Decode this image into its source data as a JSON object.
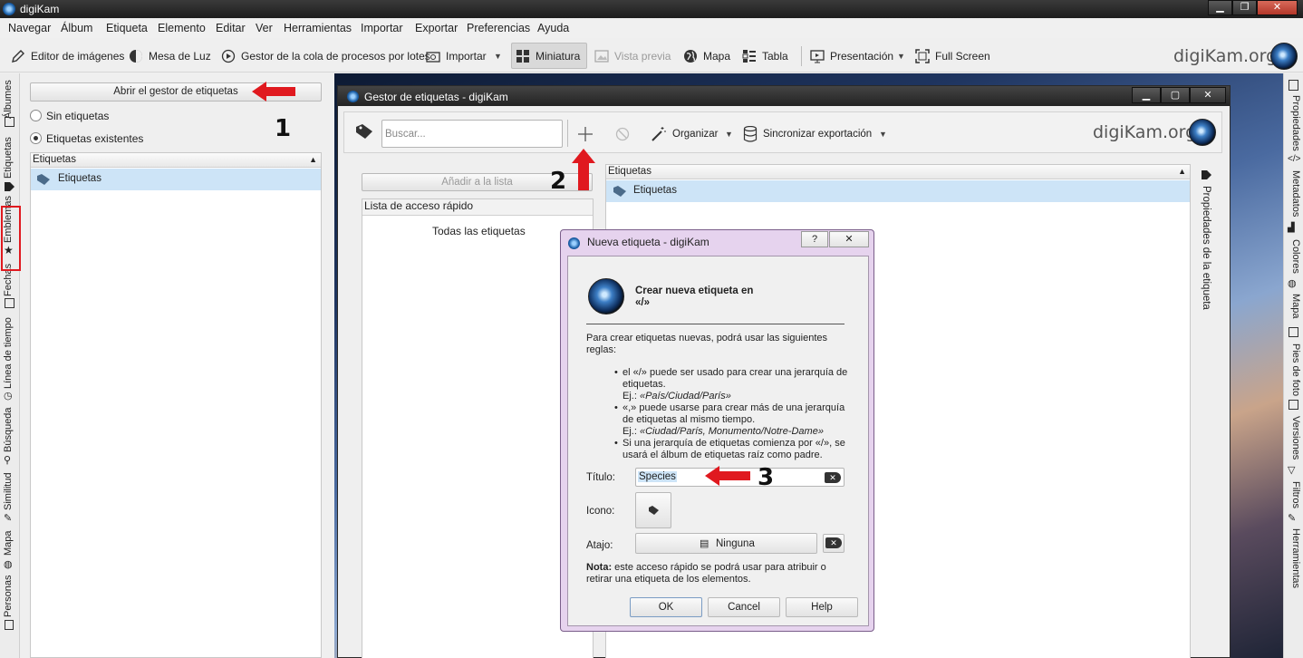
{
  "window": {
    "title": "digiKam"
  },
  "menu": [
    "Navegar",
    "Álbum",
    "Etiqueta",
    "Elemento",
    "Editar",
    "Ver",
    "Herramientas",
    "Importar",
    "Exportar",
    "Preferencias",
    "Ayuda"
  ],
  "toolbar": {
    "items": [
      {
        "label": "Editor de imágenes",
        "icon": "pencil-icon"
      },
      {
        "label": "Mesa de Luz",
        "icon": "lighttable-icon"
      },
      {
        "label": "Gestor de la cola de procesos por lotes",
        "icon": "batch-queue-icon"
      },
      {
        "label": "Importar",
        "icon": "camera-icon"
      },
      {
        "label": "Miniatura",
        "icon": "thumbnail-grid-icon",
        "active": true
      },
      {
        "label": "Vista previa",
        "icon": "preview-image-icon",
        "disabled": true
      },
      {
        "label": "Mapa",
        "icon": "globe-icon"
      },
      {
        "label": "Tabla",
        "icon": "table-icon"
      },
      {
        "label": "Presentación",
        "icon": "slideshow-icon"
      },
      {
        "label": "Full Screen",
        "icon": "fullscreen-icon"
      }
    ],
    "brand": "digiKam.org"
  },
  "left_tabs": [
    "Álbumes",
    "Etiquetas",
    "Emblemas",
    "Fechas",
    "Línea de tiempo",
    "Búsqueda",
    "Similitud",
    "Mapa",
    "Personas"
  ],
  "right_tabs": [
    "Propiedades",
    "Metadatos",
    "Colores",
    "Mapa",
    "Pies de foto",
    "Versiones",
    "Filtros",
    "Herramientas"
  ],
  "left_panel": {
    "open_manager_button": "Abrir el gestor de etiquetas",
    "radio_no_tags": "Sin etiquetas",
    "radio_existing_tags": "Etiquetas existentes",
    "tree_header": "Etiquetas",
    "tree_root": "Etiquetas"
  },
  "tag_manager": {
    "title": "Gestor de etiquetas - digiKam",
    "search_placeholder": "Buscar...",
    "organize_label": "Organizar",
    "sync_export_label": "Sincronizar exportación",
    "brand": "digiKam.org",
    "add_to_list": "Añadir a la lista",
    "quick_access_header": "Lista de acceso rápido",
    "all_tags": "Todas las etiquetas",
    "tree_header": "Etiquetas",
    "tree_root": "Etiquetas",
    "side_tab": "Propiedades de la etiqueta"
  },
  "dialog": {
    "title": "Nueva etiqueta - digiKam",
    "help_btn": "?",
    "close_btn": "✕",
    "heading_line1": "Crear nueva etiqueta en",
    "heading_line2": "«/»",
    "intro": "Para crear etiquetas nuevas, podrá usar las siguientes reglas:",
    "rule1": "el «/» puede ser usado para crear una jerarquía de etiquetas.",
    "rule1_example_prefix": "Ej.: ",
    "rule1_example": "«País/Ciudad/París»",
    "rule2": "«,» puede usarse para crear más de una jerarquía de etiquetas al mismo tiempo.",
    "rule2_example_prefix": "Ej.: ",
    "rule2_example": "«Ciudad/París, Monumento/Notre-Dame»",
    "rule3": "Si una jerarquía de etiquetas comienza por «/», se usará el álbum de etiquetas raíz como padre.",
    "title_label": "Título:",
    "title_value": "Species",
    "icon_label": "Icono:",
    "shortcut_label": "Atajo:",
    "shortcut_value": "Ninguna",
    "note_bold": "Nota:",
    "note_text": " este acceso rápido se podrá usar para atribuir o retirar una etiqueta de los elementos.",
    "ok": "OK",
    "cancel": "Cancel",
    "help": "Help"
  },
  "annotations": {
    "step1": "1",
    "step2": "2",
    "step3": "3",
    "arrow_color": "#e0191f"
  }
}
